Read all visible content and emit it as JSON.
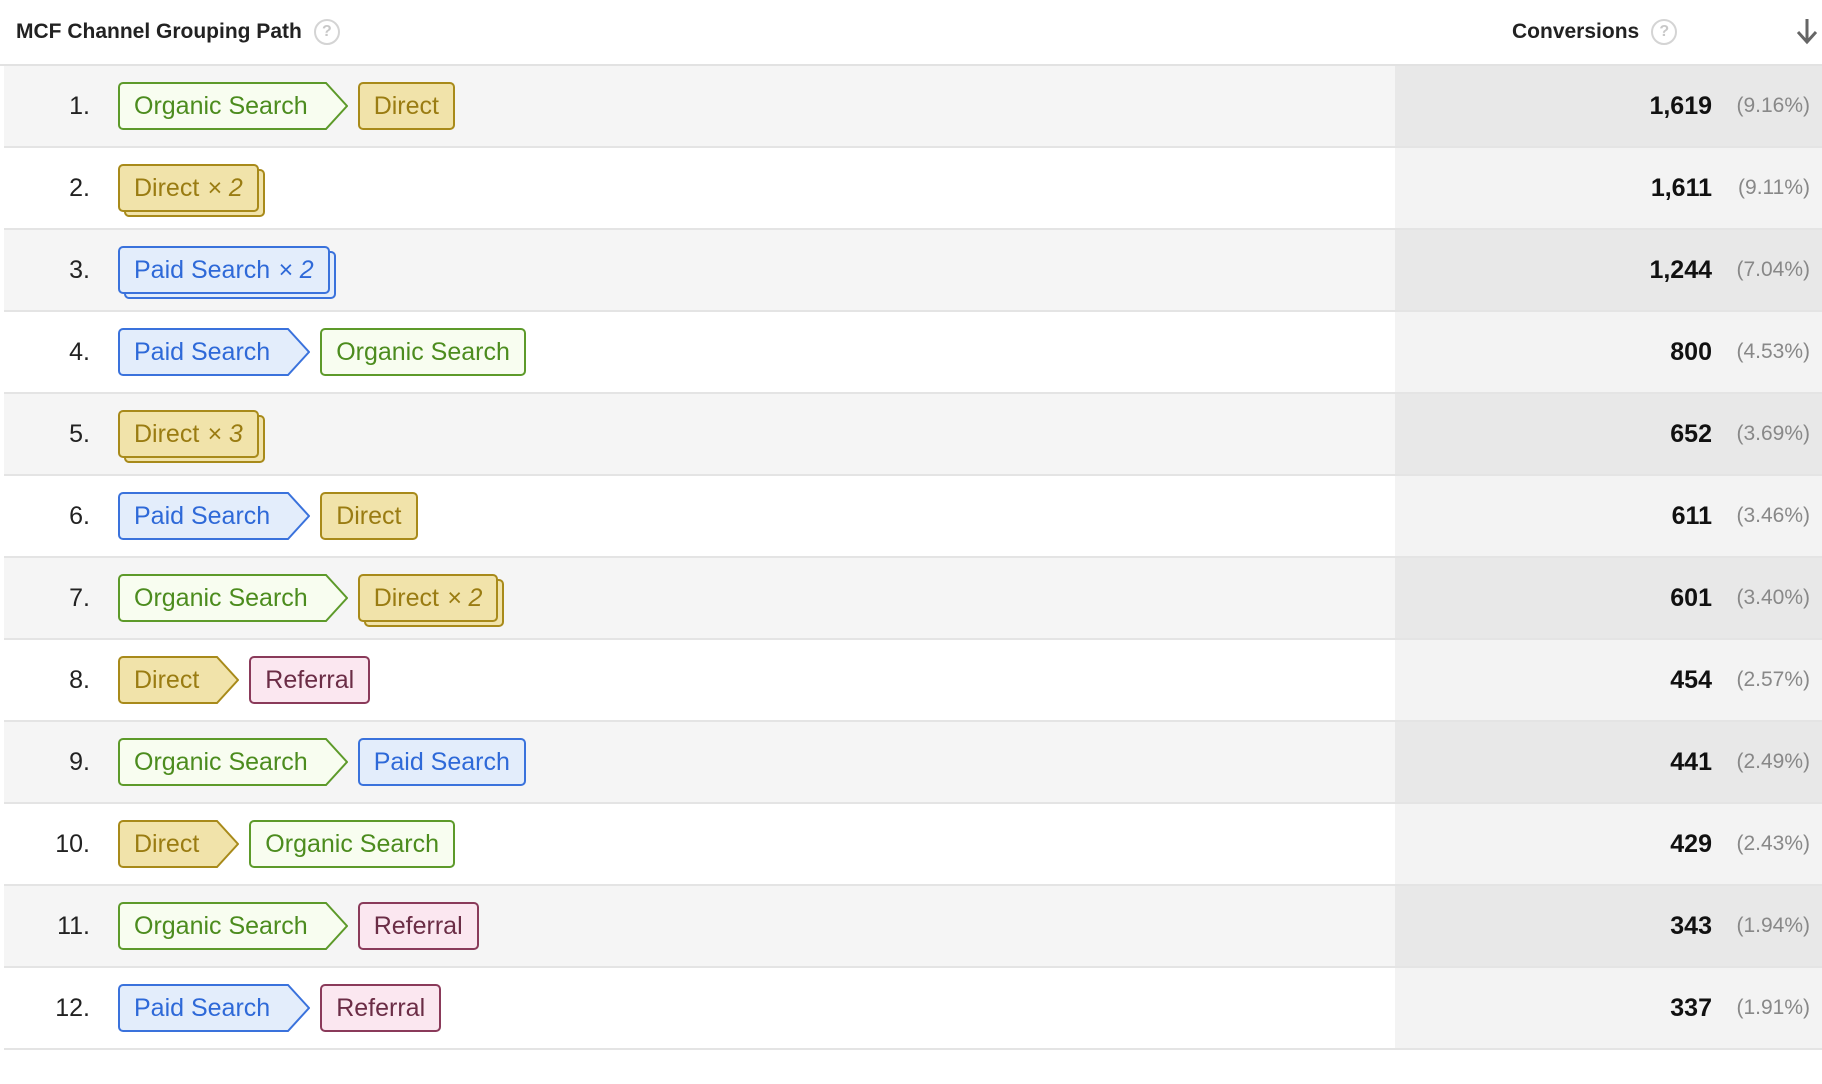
{
  "header": {
    "path_label": "MCF Channel Grouping Path",
    "conversions_label": "Conversions",
    "help_glyph": "?"
  },
  "colors": {
    "organic": "#5d9a2a",
    "direct": "#a88a1a",
    "paid": "#3a72dc",
    "referral": "#8a3a5a"
  },
  "rows": [
    {
      "index": "1.",
      "path": [
        {
          "label": "Organic Search",
          "type": "organic",
          "mult": ""
        },
        {
          "label": "Direct",
          "type": "direct",
          "mult": ""
        }
      ],
      "conversions": "1,619",
      "percent": "(9.16%)"
    },
    {
      "index": "2.",
      "path": [
        {
          "label": "Direct",
          "type": "direct",
          "mult": "× 2"
        }
      ],
      "conversions": "1,611",
      "percent": "(9.11%)"
    },
    {
      "index": "3.",
      "path": [
        {
          "label": "Paid Search",
          "type": "paid",
          "mult": "× 2"
        }
      ],
      "conversions": "1,244",
      "percent": "(7.04%)"
    },
    {
      "index": "4.",
      "path": [
        {
          "label": "Paid Search",
          "type": "paid",
          "mult": ""
        },
        {
          "label": "Organic Search",
          "type": "organic",
          "mult": ""
        }
      ],
      "conversions": "800",
      "percent": "(4.53%)"
    },
    {
      "index": "5.",
      "path": [
        {
          "label": "Direct",
          "type": "direct",
          "mult": "× 3"
        }
      ],
      "conversions": "652",
      "percent": "(3.69%)"
    },
    {
      "index": "6.",
      "path": [
        {
          "label": "Paid Search",
          "type": "paid",
          "mult": ""
        },
        {
          "label": "Direct",
          "type": "direct",
          "mult": ""
        }
      ],
      "conversions": "611",
      "percent": "(3.46%)"
    },
    {
      "index": "7.",
      "path": [
        {
          "label": "Organic Search",
          "type": "organic",
          "mult": ""
        },
        {
          "label": "Direct",
          "type": "direct",
          "mult": "× 2"
        }
      ],
      "conversions": "601",
      "percent": "(3.40%)"
    },
    {
      "index": "8.",
      "path": [
        {
          "label": "Direct",
          "type": "direct",
          "mult": ""
        },
        {
          "label": "Referral",
          "type": "referral",
          "mult": ""
        }
      ],
      "conversions": "454",
      "percent": "(2.57%)"
    },
    {
      "index": "9.",
      "path": [
        {
          "label": "Organic Search",
          "type": "organic",
          "mult": ""
        },
        {
          "label": "Paid Search",
          "type": "paid",
          "mult": ""
        }
      ],
      "conversions": "441",
      "percent": "(2.49%)"
    },
    {
      "index": "10.",
      "path": [
        {
          "label": "Direct",
          "type": "direct",
          "mult": ""
        },
        {
          "label": "Organic Search",
          "type": "organic",
          "mult": ""
        }
      ],
      "conversions": "429",
      "percent": "(2.43%)"
    },
    {
      "index": "11.",
      "path": [
        {
          "label": "Organic Search",
          "type": "organic",
          "mult": ""
        },
        {
          "label": "Referral",
          "type": "referral",
          "mult": ""
        }
      ],
      "conversions": "343",
      "percent": "(1.94%)"
    },
    {
      "index": "12.",
      "path": [
        {
          "label": "Paid Search",
          "type": "paid",
          "mult": ""
        },
        {
          "label": "Referral",
          "type": "referral",
          "mult": ""
        }
      ],
      "conversions": "337",
      "percent": "(1.91%)"
    }
  ]
}
